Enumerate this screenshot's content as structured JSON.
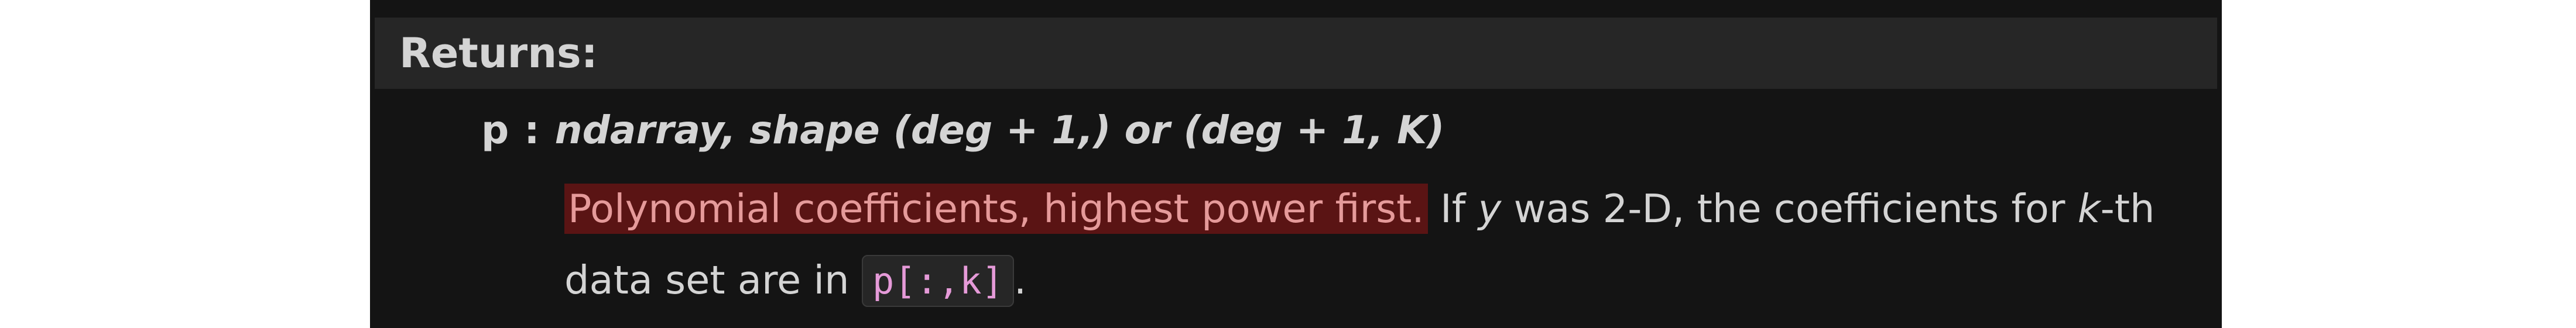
{
  "section": {
    "title": "Returns:"
  },
  "param": {
    "name": "p",
    "separator": ":",
    "type": "ndarray, shape (deg + 1,) or (deg + 1, K)"
  },
  "description": {
    "highlighted": "Polynomial coefficients, highest power first.",
    "text_1": " If ",
    "var_y": "y",
    "text_2": " was 2-D, the coefficients for ",
    "var_k": "k",
    "text_3": "-th data set are in ",
    "code": "p[:,k]",
    "text_4": "."
  },
  "colors": {
    "panel_background": "#141414",
    "header_background": "#262626",
    "text": "#d4d4d4",
    "highlight_background": "#5a1414",
    "highlight_text": "#e59a9a",
    "code_text": "#e59ad8"
  }
}
